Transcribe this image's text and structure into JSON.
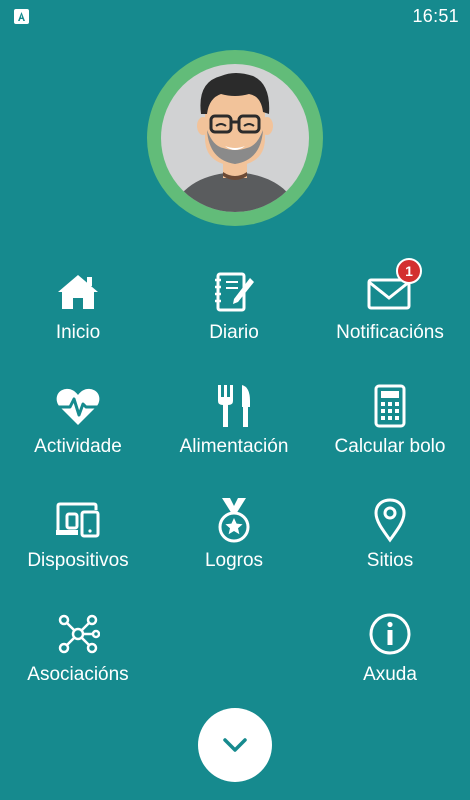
{
  "status_bar": {
    "time": "16:51",
    "app_icon": "a-icon"
  },
  "profile": {
    "avatar": "user-avatar",
    "ring_color": "#62BC79"
  },
  "menu": {
    "items": [
      {
        "label": "Inicio",
        "icon": "home-icon"
      },
      {
        "label": "Diario",
        "icon": "notebook-icon"
      },
      {
        "label": "Notificacións",
        "icon": "envelope-icon",
        "badge": "1"
      },
      {
        "label": "Actividade",
        "icon": "heartbeat-icon"
      },
      {
        "label": "Alimentación",
        "icon": "fork-knife-icon"
      },
      {
        "label": "Calcular bolo",
        "icon": "calculator-icon"
      },
      {
        "label": "Dispositivos",
        "icon": "devices-icon"
      },
      {
        "label": "Logros",
        "icon": "medal-icon"
      },
      {
        "label": "Sitios",
        "icon": "location-pin-icon"
      },
      {
        "label": "Asociacións",
        "icon": "network-icon"
      },
      {
        "label": "Axuda",
        "icon": "info-icon"
      }
    ]
  },
  "expand_button": {
    "icon": "chevron-down-icon"
  },
  "colors": {
    "background": "#168A8E",
    "badge": "#D32F2F",
    "foreground": "#FFFFFF"
  }
}
